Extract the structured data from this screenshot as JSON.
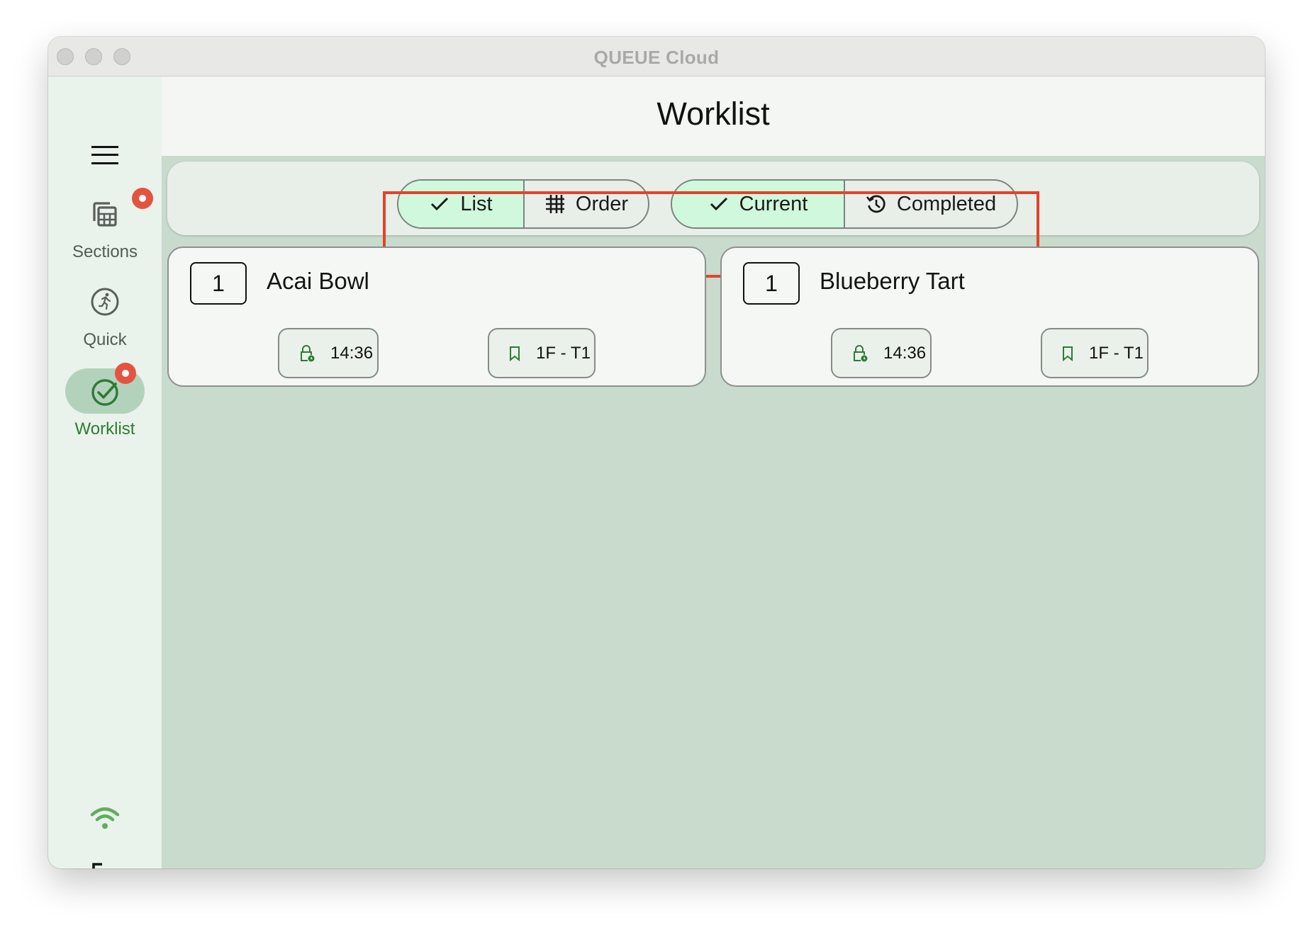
{
  "window": {
    "title": "QUEUE Cloud"
  },
  "header": {
    "title": "Worklist"
  },
  "sidebar": {
    "menu_icon": "hamburger-menu-icon",
    "items": [
      {
        "label": "Sections",
        "icon": "calculator-grid-icon",
        "badge": true,
        "active": false
      },
      {
        "label": "Quick",
        "icon": "running-person-icon",
        "badge": false,
        "active": false
      },
      {
        "label": "Worklist",
        "icon": "check-circle-icon",
        "badge": true,
        "active": true
      }
    ],
    "bottom": [
      {
        "icon": "wifi-icon",
        "status": "connected"
      },
      {
        "icon": "logout-icon"
      }
    ]
  },
  "toolbar": {
    "view_toggle": [
      {
        "label": "List",
        "icon": "check-icon",
        "selected": true
      },
      {
        "label": "Order",
        "icon": "hash-grid-icon",
        "selected": false
      }
    ],
    "status_toggle": [
      {
        "label": "Current",
        "icon": "check-icon",
        "selected": true
      },
      {
        "label": "Completed",
        "icon": "history-icon",
        "selected": false
      }
    ]
  },
  "orders": [
    {
      "quantity": "1",
      "name": "Acai Bowl",
      "time": "14:36",
      "location": "1F - T1"
    },
    {
      "quantity": "1",
      "name": "Blueberry Tart",
      "time": "14:36",
      "location": "1F - T1"
    }
  ],
  "colors": {
    "accent_green": "#2f7a35",
    "selected_segment": "#cff8dc",
    "badge_red": "#e4533f",
    "highlight_red": "#e2432c",
    "wifi_green": "#5fae5c"
  }
}
